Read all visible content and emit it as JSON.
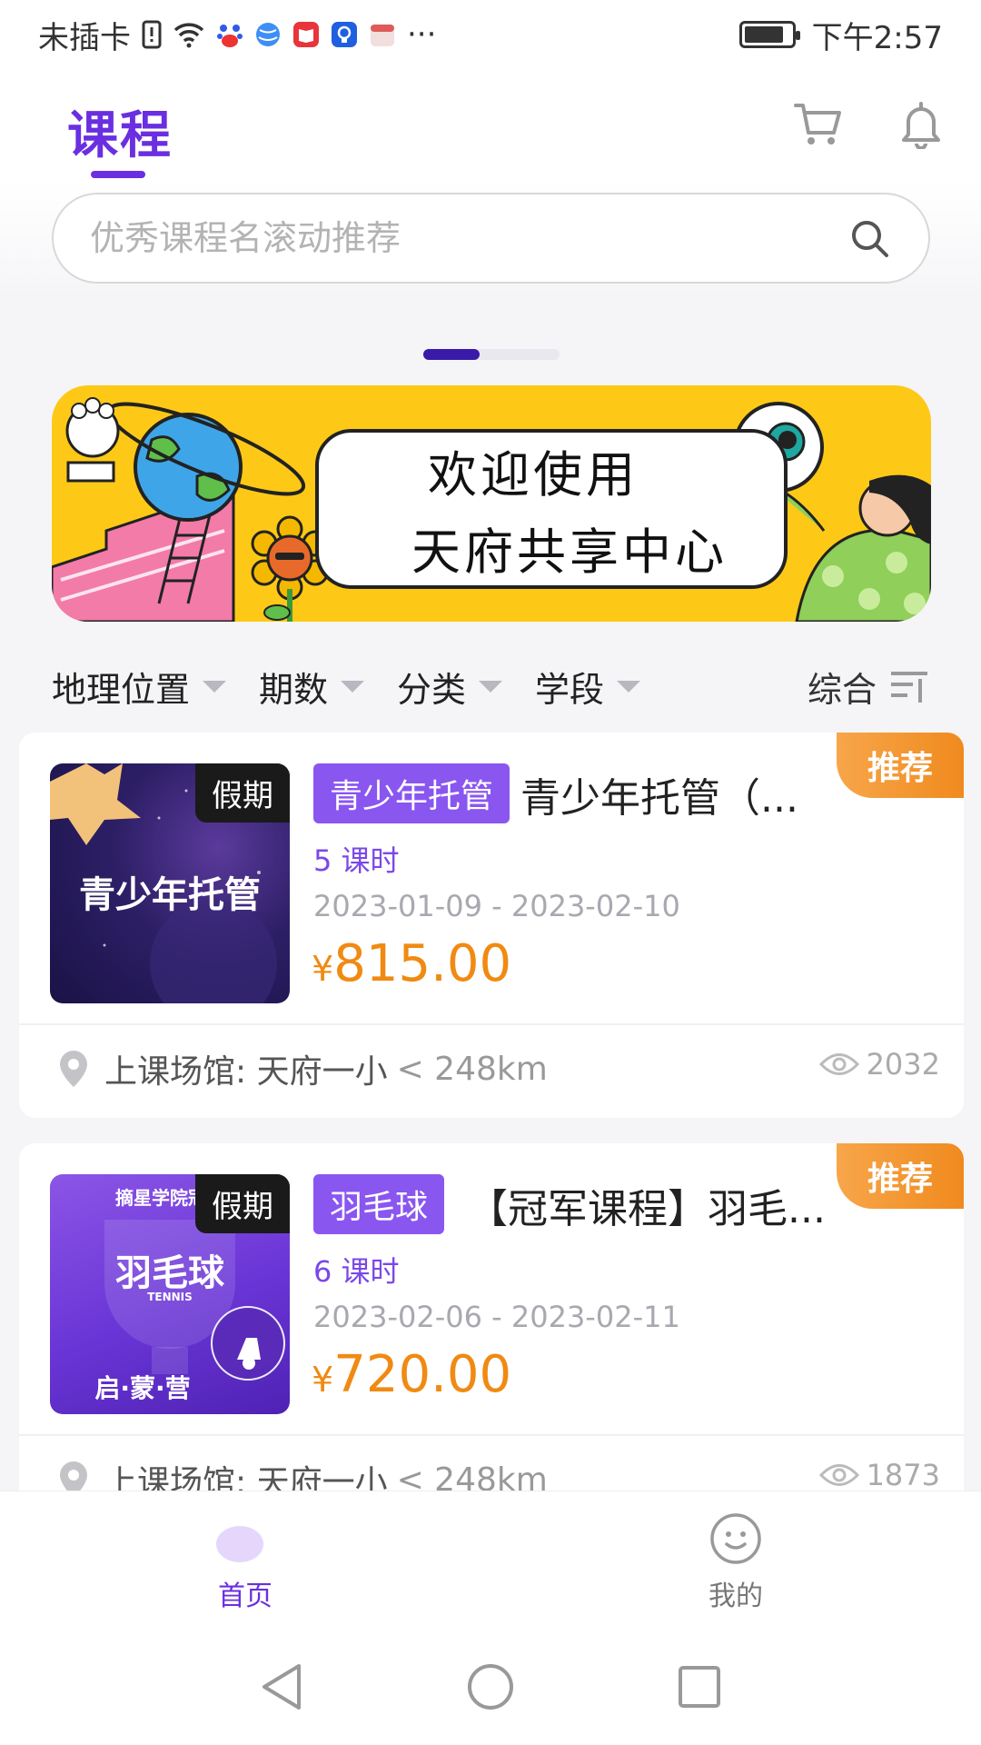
{
  "status_bar": {
    "carrier": "未插卡",
    "more": "···",
    "time": "下午2:57",
    "battery_level": 0.85
  },
  "header": {
    "title": "课程",
    "cart_icon": "cart-icon",
    "bell_icon": "bell-icon"
  },
  "search": {
    "placeholder": "优秀课程名滚动推荐",
    "value": ""
  },
  "banner": {
    "line1": "欢迎使用",
    "line2": "天府共享中心",
    "background": "#FDC916",
    "active_page": 1,
    "pages": 2
  },
  "filters": {
    "items": [
      "地理位置",
      "期数",
      "分类",
      "学段"
    ],
    "sort_label": "综合"
  },
  "courses": [
    {
      "thumb_text": "青少年托管",
      "badge": "假期",
      "tag": "青少年托管",
      "title": "青少年托管（...",
      "hours": "5 课时",
      "dates": "2023-01-09 - 2023-02-10",
      "currency": "¥",
      "price": "815.00",
      "recommend": "推荐",
      "venue": "上课场馆: 天府一小",
      "distance": "< 248km",
      "views": "2032"
    },
    {
      "thumb_text": "羽毛球",
      "thumb_top": "摘星学院冠军",
      "thumb_sub": "TENNIS",
      "thumb_bottom": "启·蒙·营",
      "badge": "假期",
      "tag": "羽毛球",
      "title": "【冠军课程】羽毛...",
      "hours": "6 课时",
      "dates": "2023-02-06 - 2023-02-11",
      "currency": "¥",
      "price": "720.00",
      "recommend": "推荐",
      "venue": "上课场馆: 天府一小",
      "distance": "< 248km",
      "views": "1873"
    }
  ],
  "tabbar": {
    "home": "首页",
    "me": "我的"
  },
  "colors": {
    "accent": "#6A2FE0",
    "price": "#F08A12",
    "tag": "#8A56F0",
    "recommend": "#F08A1E"
  }
}
